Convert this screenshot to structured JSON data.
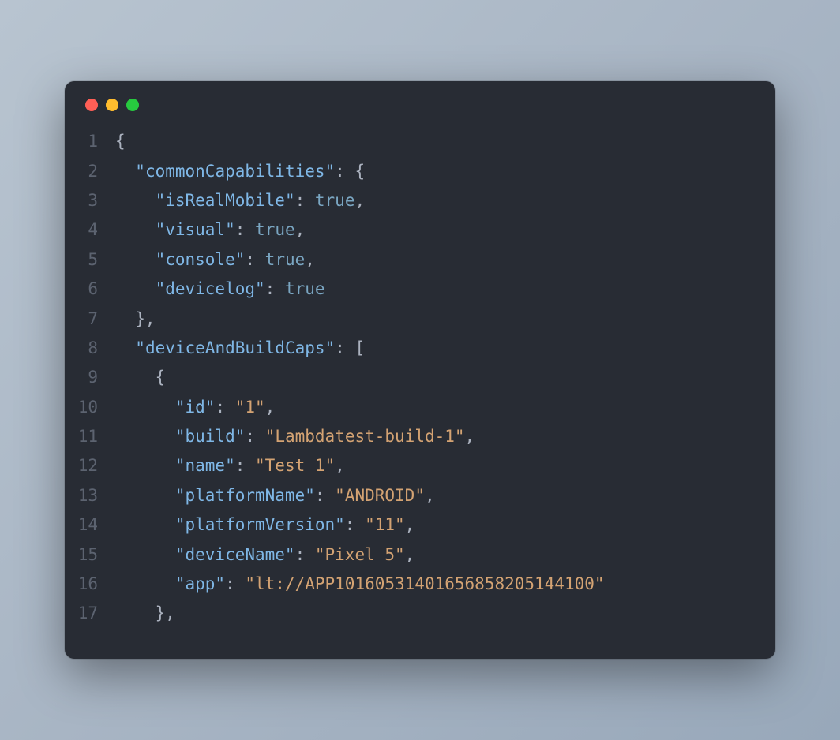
{
  "colors": {
    "bg": "#282c34",
    "gutter": "#5c6370",
    "punct": "#abb2bf",
    "key": "#7fb7e6",
    "string": "#d4a373",
    "bool": "#7aa6c2",
    "dotRed": "#ff5f56",
    "dotYellow": "#ffbd2e",
    "dotGreen": "#27c93f"
  },
  "lines": [
    {
      "n": "1",
      "tokens": [
        {
          "c": "p",
          "t": "{"
        }
      ]
    },
    {
      "n": "2",
      "tokens": [
        {
          "c": "p",
          "t": "  "
        },
        {
          "c": "k",
          "t": "\"commonCapabilities\""
        },
        {
          "c": "p",
          "t": ": {"
        }
      ]
    },
    {
      "n": "3",
      "tokens": [
        {
          "c": "p",
          "t": "    "
        },
        {
          "c": "k",
          "t": "\"isRealMobile\""
        },
        {
          "c": "p",
          "t": ": "
        },
        {
          "c": "b",
          "t": "true"
        },
        {
          "c": "p",
          "t": ","
        }
      ]
    },
    {
      "n": "4",
      "tokens": [
        {
          "c": "p",
          "t": "    "
        },
        {
          "c": "k",
          "t": "\"visual\""
        },
        {
          "c": "p",
          "t": ": "
        },
        {
          "c": "b",
          "t": "true"
        },
        {
          "c": "p",
          "t": ","
        }
      ]
    },
    {
      "n": "5",
      "tokens": [
        {
          "c": "p",
          "t": "    "
        },
        {
          "c": "k",
          "t": "\"console\""
        },
        {
          "c": "p",
          "t": ": "
        },
        {
          "c": "b",
          "t": "true"
        },
        {
          "c": "p",
          "t": ","
        }
      ]
    },
    {
      "n": "6",
      "tokens": [
        {
          "c": "p",
          "t": "    "
        },
        {
          "c": "k",
          "t": "\"devicelog\""
        },
        {
          "c": "p",
          "t": ": "
        },
        {
          "c": "b",
          "t": "true"
        }
      ]
    },
    {
      "n": "7",
      "tokens": [
        {
          "c": "p",
          "t": "  },"
        }
      ]
    },
    {
      "n": "8",
      "tokens": [
        {
          "c": "p",
          "t": "  "
        },
        {
          "c": "k",
          "t": "\"deviceAndBuildCaps\""
        },
        {
          "c": "p",
          "t": ": ["
        }
      ]
    },
    {
      "n": "9",
      "tokens": [
        {
          "c": "p",
          "t": "    {"
        }
      ]
    },
    {
      "n": "10",
      "tokens": [
        {
          "c": "p",
          "t": "      "
        },
        {
          "c": "k",
          "t": "\"id\""
        },
        {
          "c": "p",
          "t": ": "
        },
        {
          "c": "s",
          "t": "\"1\""
        },
        {
          "c": "p",
          "t": ","
        }
      ]
    },
    {
      "n": "11",
      "tokens": [
        {
          "c": "p",
          "t": "      "
        },
        {
          "c": "k",
          "t": "\"build\""
        },
        {
          "c": "p",
          "t": ": "
        },
        {
          "c": "s",
          "t": "\"Lambdatest-build-1\""
        },
        {
          "c": "p",
          "t": ","
        }
      ]
    },
    {
      "n": "12",
      "tokens": [
        {
          "c": "p",
          "t": "      "
        },
        {
          "c": "k",
          "t": "\"name\""
        },
        {
          "c": "p",
          "t": ": "
        },
        {
          "c": "s",
          "t": "\"Test 1\""
        },
        {
          "c": "p",
          "t": ","
        }
      ]
    },
    {
      "n": "13",
      "tokens": [
        {
          "c": "p",
          "t": "      "
        },
        {
          "c": "k",
          "t": "\"platformName\""
        },
        {
          "c": "p",
          "t": ": "
        },
        {
          "c": "s",
          "t": "\"ANDROID\""
        },
        {
          "c": "p",
          "t": ","
        }
      ]
    },
    {
      "n": "14",
      "tokens": [
        {
          "c": "p",
          "t": "      "
        },
        {
          "c": "k",
          "t": "\"platformVersion\""
        },
        {
          "c": "p",
          "t": ": "
        },
        {
          "c": "s",
          "t": "\"11\""
        },
        {
          "c": "p",
          "t": ","
        }
      ]
    },
    {
      "n": "15",
      "tokens": [
        {
          "c": "p",
          "t": "      "
        },
        {
          "c": "k",
          "t": "\"deviceName\""
        },
        {
          "c": "p",
          "t": ": "
        },
        {
          "c": "s",
          "t": "\"Pixel 5\""
        },
        {
          "c": "p",
          "t": ","
        }
      ]
    },
    {
      "n": "16",
      "tokens": [
        {
          "c": "p",
          "t": "      "
        },
        {
          "c": "k",
          "t": "\"app\""
        },
        {
          "c": "p",
          "t": ": "
        },
        {
          "c": "s",
          "t": "\"lt://APP10160531401656858205144100\""
        }
      ]
    },
    {
      "n": "17",
      "tokens": [
        {
          "c": "p",
          "t": "    },"
        }
      ]
    }
  ],
  "code_value": {
    "commonCapabilities": {
      "isRealMobile": true,
      "visual": true,
      "console": true,
      "devicelog": true
    },
    "deviceAndBuildCaps": [
      {
        "id": "1",
        "build": "Lambdatest-build-1",
        "name": "Test 1",
        "platformName": "ANDROID",
        "platformVersion": "11",
        "deviceName": "Pixel 5",
        "app": "lt://APP10160531401656858205144100"
      }
    ]
  }
}
